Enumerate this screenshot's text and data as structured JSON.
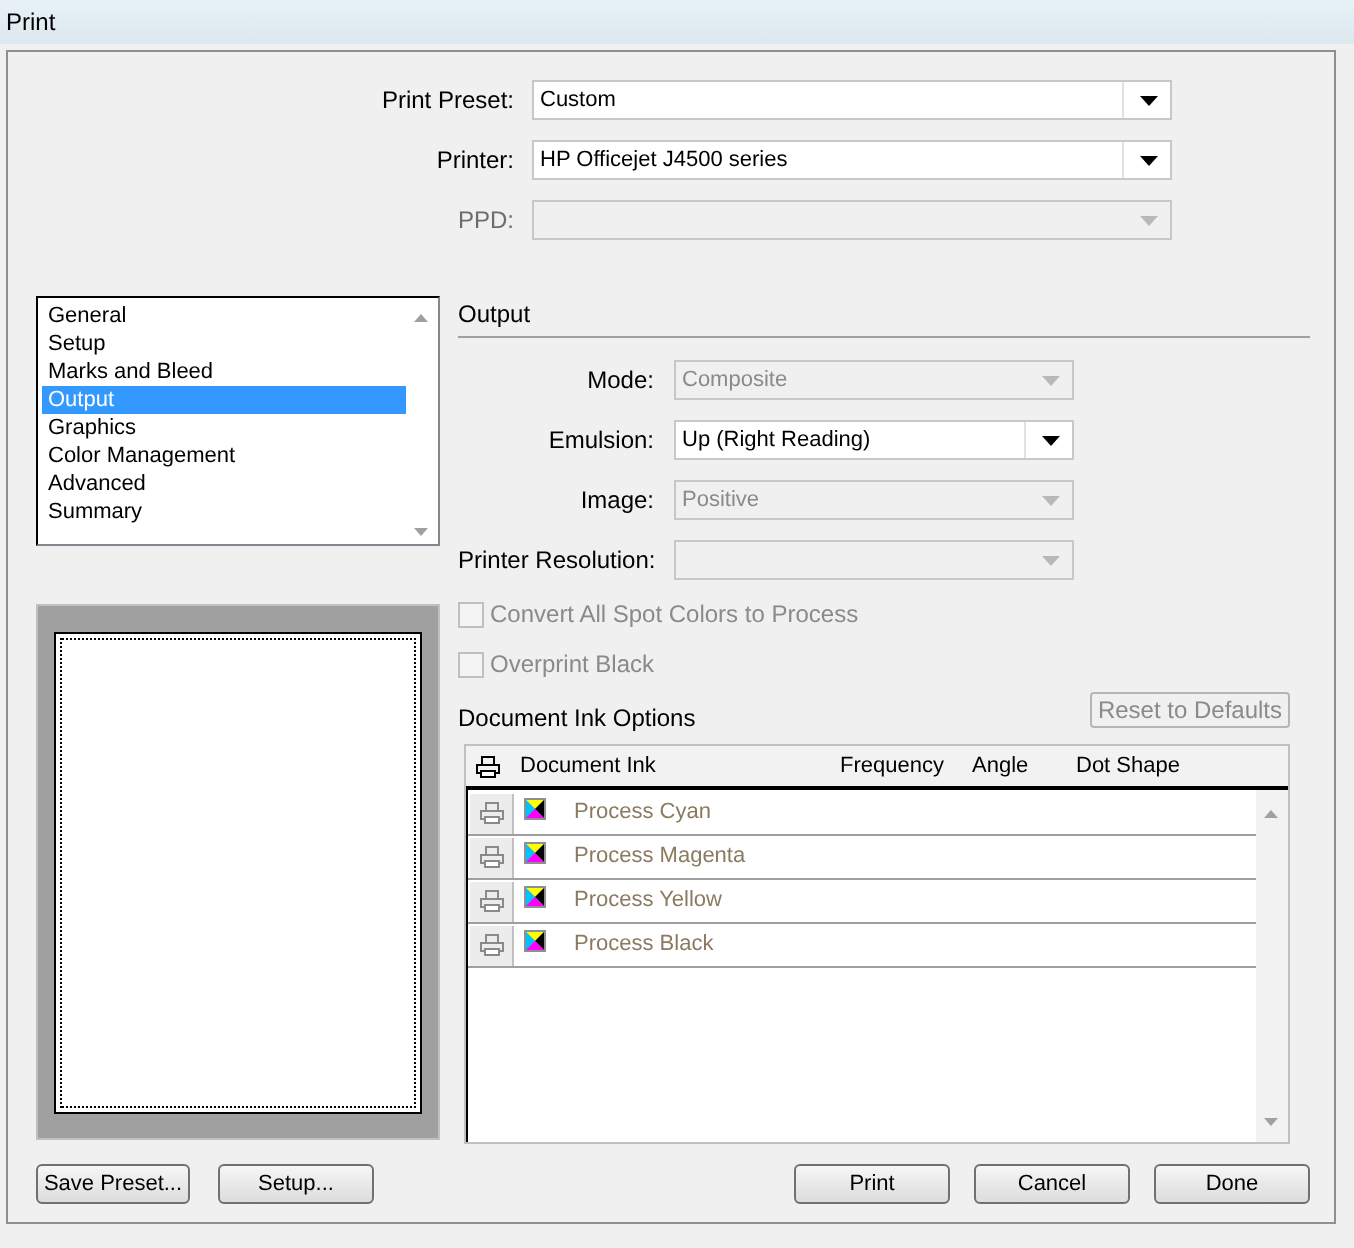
{
  "window": {
    "title": "Print"
  },
  "top_fields": [
    {
      "label": "Print Preset:",
      "value": "Custom",
      "disabled": false
    },
    {
      "label": "Printer:",
      "value": "HP Officejet J4500 series",
      "disabled": false
    },
    {
      "label": "PPD:",
      "disabled": true
    }
  ],
  "sidebar": {
    "items": [
      {
        "label": "General",
        "selected": false
      },
      {
        "label": "Setup",
        "selected": false
      },
      {
        "label": "Marks and Bleed",
        "selected": false
      },
      {
        "label": "Output",
        "selected": true
      },
      {
        "label": "Graphics",
        "selected": false
      },
      {
        "label": "Color Management",
        "selected": false
      },
      {
        "label": "Advanced",
        "selected": false
      },
      {
        "label": "Summary",
        "selected": false
      }
    ]
  },
  "output": {
    "heading": "Output",
    "fields": [
      {
        "label": "Mode:",
        "value": "Composite",
        "disabled": true
      },
      {
        "label": "Emulsion:",
        "value": "Up (Right Reading)",
        "disabled": false
      },
      {
        "label": "Image:",
        "value": "Positive",
        "disabled": true
      },
      {
        "label": "Printer Resolution:",
        "disabled": true
      }
    ],
    "checkboxes": [
      {
        "label": "Convert All Spot Colors to Process",
        "checked": false,
        "disabled": true
      },
      {
        "label": "Overprint Black",
        "checked": false,
        "disabled": true
      }
    ],
    "ink_heading": "Document Ink Options",
    "reset_button": {
      "label": "Reset to Defaults",
      "disabled": true
    },
    "table": {
      "columns": [
        "Document Ink",
        "Frequency",
        "Angle",
        "Dot Shape"
      ],
      "rows": [
        {
          "name": "Process Cyan"
        },
        {
          "name": "Process Magenta"
        },
        {
          "name": "Process Yellow"
        },
        {
          "name": "Process Black"
        }
      ]
    }
  },
  "left_buttons": [
    "Save Preset...",
    "Setup..."
  ],
  "right_buttons": [
    "Print",
    "Cancel",
    "Done"
  ]
}
